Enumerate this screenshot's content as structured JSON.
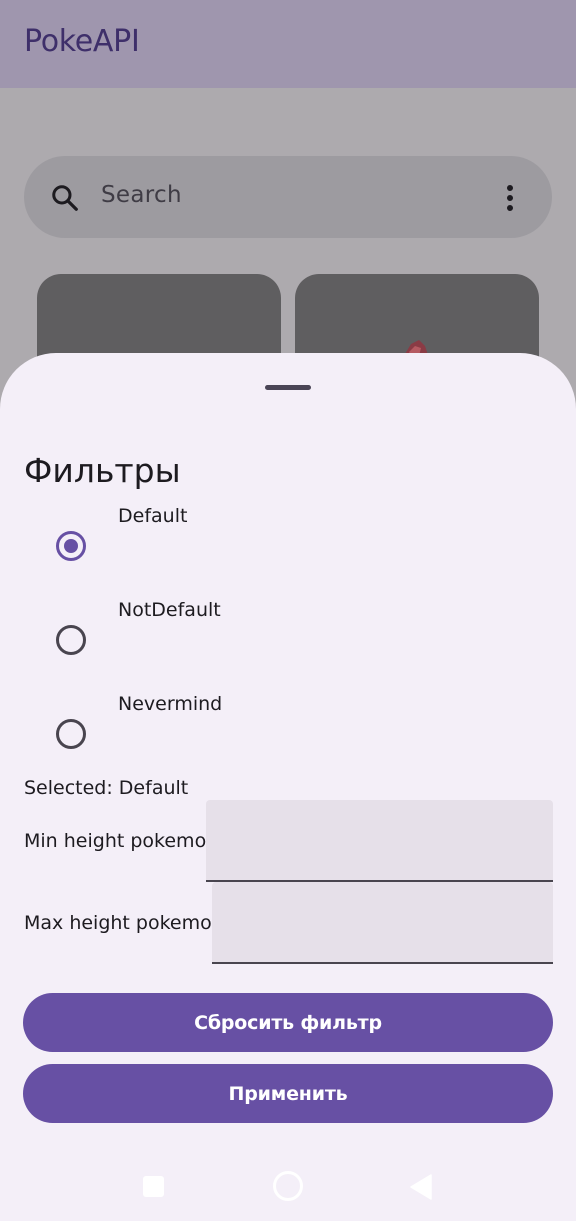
{
  "app": {
    "title": "PokeAPI"
  },
  "search": {
    "placeholder": "Search"
  },
  "sheet": {
    "title": "Фильтры",
    "radio_options": [
      {
        "label": "Default",
        "checked": true
      },
      {
        "label": "NotDefault",
        "checked": false
      },
      {
        "label": "Nevermind",
        "checked": false
      }
    ],
    "selected_text": "Selected: Default",
    "min_height_label": "Min height pokemon",
    "min_height_value": "",
    "max_height_label": "Max height pokemon",
    "max_height_value": "",
    "reset_button": "Сбросить фильтр",
    "apply_button": "Применить"
  },
  "colors": {
    "primary": "#6750a4",
    "sheet_background": "#f4eff8",
    "scrim": "#adaaae",
    "app_bar": "#9f96ae",
    "field_background": "#e6e0e9"
  },
  "icons": {
    "search": "search-icon",
    "more": "more-vert-icon",
    "nav_recents": "square-nav-icon",
    "nav_home": "circle-nav-icon",
    "nav_back": "triangle-back-icon"
  }
}
